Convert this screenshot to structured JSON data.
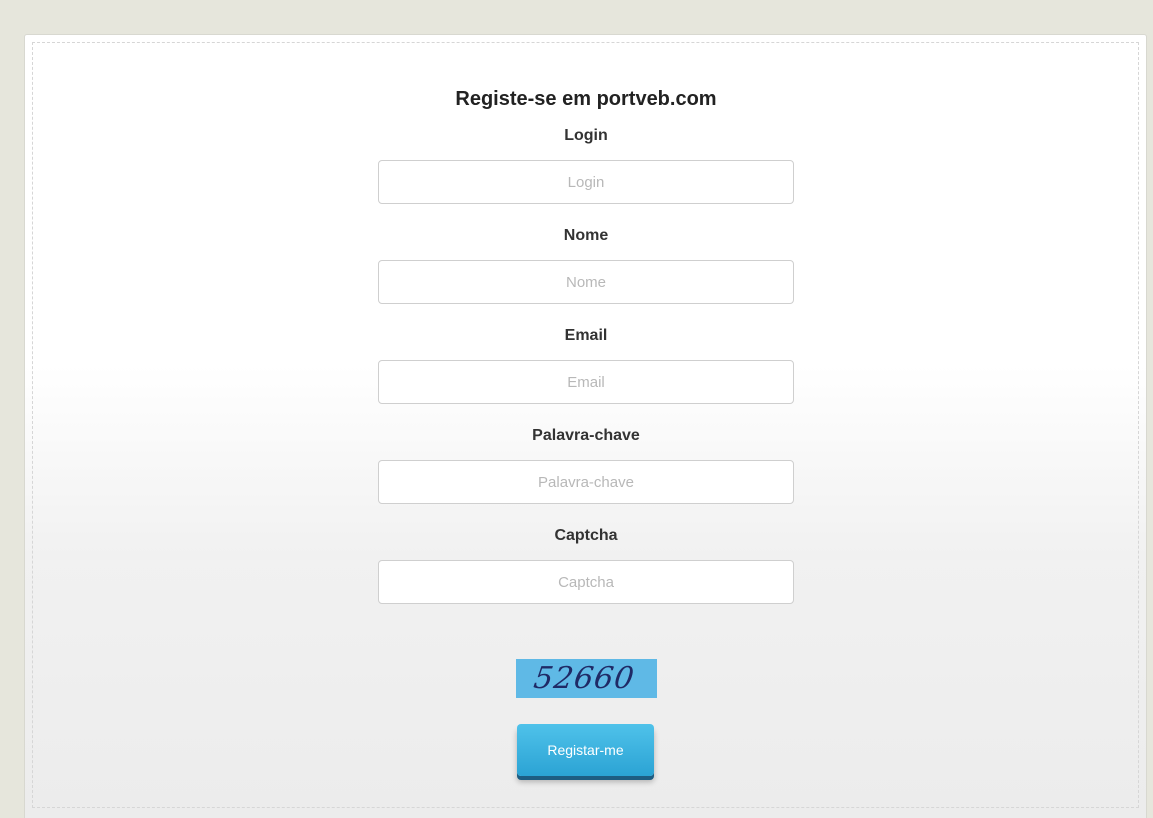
{
  "form": {
    "title": "Registe-se em portveb.com",
    "fields": [
      {
        "label": "Login",
        "placeholder": "Login",
        "value": ""
      },
      {
        "label": "Nome",
        "placeholder": "Nome",
        "value": ""
      },
      {
        "label": "Email",
        "placeholder": "Email",
        "value": ""
      },
      {
        "label": "Palavra-chave",
        "placeholder": "Palavra-chave",
        "value": ""
      },
      {
        "label": "Captcha",
        "placeholder": "Captcha",
        "value": ""
      }
    ],
    "captcha_text": "52660",
    "submit_label": "Registar-me"
  },
  "colors": {
    "page_background": "#e6e6dc",
    "button": "#2ba3d4",
    "captcha_background": "#5fb9e6"
  }
}
